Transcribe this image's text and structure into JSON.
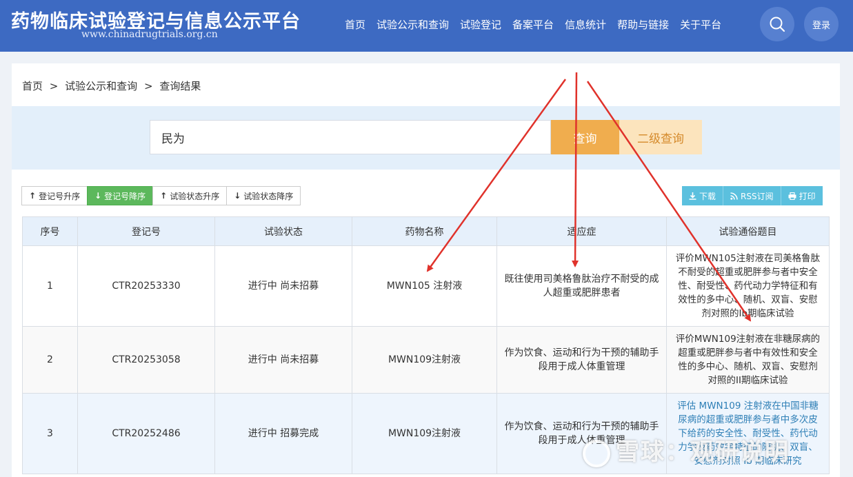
{
  "header": {
    "title": "药物临床试验登记与信息公示平台",
    "url": "www.chinadrugtrials.org.cn",
    "nav": [
      "首页",
      "试验公示和查询",
      "试验登记",
      "备案平台",
      "信息统计",
      "帮助与链接",
      "关于平台"
    ],
    "search_icon": "search-icon",
    "login_label": "登录"
  },
  "breadcrumb": [
    "首页",
    ">",
    "试验公示和查询",
    ">",
    "查询结果"
  ],
  "search": {
    "value": "民为",
    "query_label": "查询",
    "advanced_label": "二级查询"
  },
  "sort_buttons": [
    {
      "arrow": "↑",
      "label": "登记号升序",
      "active": false
    },
    {
      "arrow": "↓",
      "label": "登记号降序",
      "active": true
    },
    {
      "arrow": "↑",
      "label": "试验状态升序",
      "active": false
    },
    {
      "arrow": "↓",
      "label": "试验状态降序",
      "active": false
    }
  ],
  "actions": {
    "download": "下载",
    "rss": "RSS订阅",
    "print": "打印"
  },
  "table": {
    "headers": [
      "序号",
      "登记号",
      "试验状态",
      "药物名称",
      "适应症",
      "试验通俗题目"
    ],
    "rows": [
      {
        "no": "1",
        "reg": "CTR20253330",
        "status": "进行中 尚未招募",
        "drug": "MWN105 注射液",
        "indication": "既往使用司美格鲁肽治疗不耐受的成人超重或肥胖患者",
        "title": "评价MWN105注射液在司美格鲁肽不耐受的超重或肥胖参与者中安全性、耐受性、药代动力学特征和有效性的多中心、随机、双盲、安慰剂对照的Ⅰb期临床试验"
      },
      {
        "no": "2",
        "reg": "CTR20253058",
        "status": "进行中 尚未招募",
        "drug": "MWN109注射液",
        "indication": "作为饮食、运动和行为干预的辅助手段用于成人体重管理",
        "title": "评价MWN109注射液在非糖尿病的超重或肥胖参与者中有效性和安全性的多中心、随机、双盲、安慰剂对照的II期临床试验"
      },
      {
        "no": "3",
        "reg": "CTR20252486",
        "status": "进行中 招募完成",
        "drug": "MWN109注射液",
        "indication": "作为饮食、运动和行为干预的辅助手段用于成人体重管理",
        "title": "评估 MWN109 注射液在中国非糖尿病的超重或肥胖参与者中多次皮下给药的安全性、耐受性、药代动力学及药效学特征的随机、双盲、安慰剂对照 Ⅰb 期临床研究"
      }
    ]
  },
  "watermark": "雪球：观研说明"
}
